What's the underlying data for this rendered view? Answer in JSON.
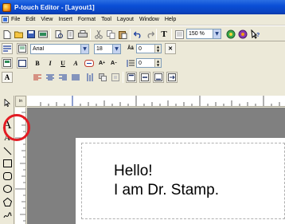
{
  "window": {
    "title": "P-touch Editor - [Layout1]"
  },
  "menu": [
    "File",
    "Edit",
    "View",
    "Insert",
    "Format",
    "Tool",
    "Layout",
    "Window",
    "Help"
  ],
  "toolbar": {
    "zoom": "150 %",
    "font_name": "Arial",
    "font_size": "18",
    "char_spacing": "0",
    "line_spacing": "0"
  },
  "ruler": {
    "unit": "in"
  },
  "label": {
    "line1": "Hello!",
    "line2": "I am Dr. Stamp."
  },
  "colors": {
    "title_bar": "#0a4ed6",
    "highlight": "#e31b23",
    "canvas": "#808080"
  },
  "tools": [
    "pointer-icon",
    "text-icon",
    "vertical-text-icon",
    "line-icon",
    "rectangle-icon",
    "rounded-rectangle-icon",
    "ellipse-icon",
    "polygon-icon",
    "freehand-icon"
  ]
}
